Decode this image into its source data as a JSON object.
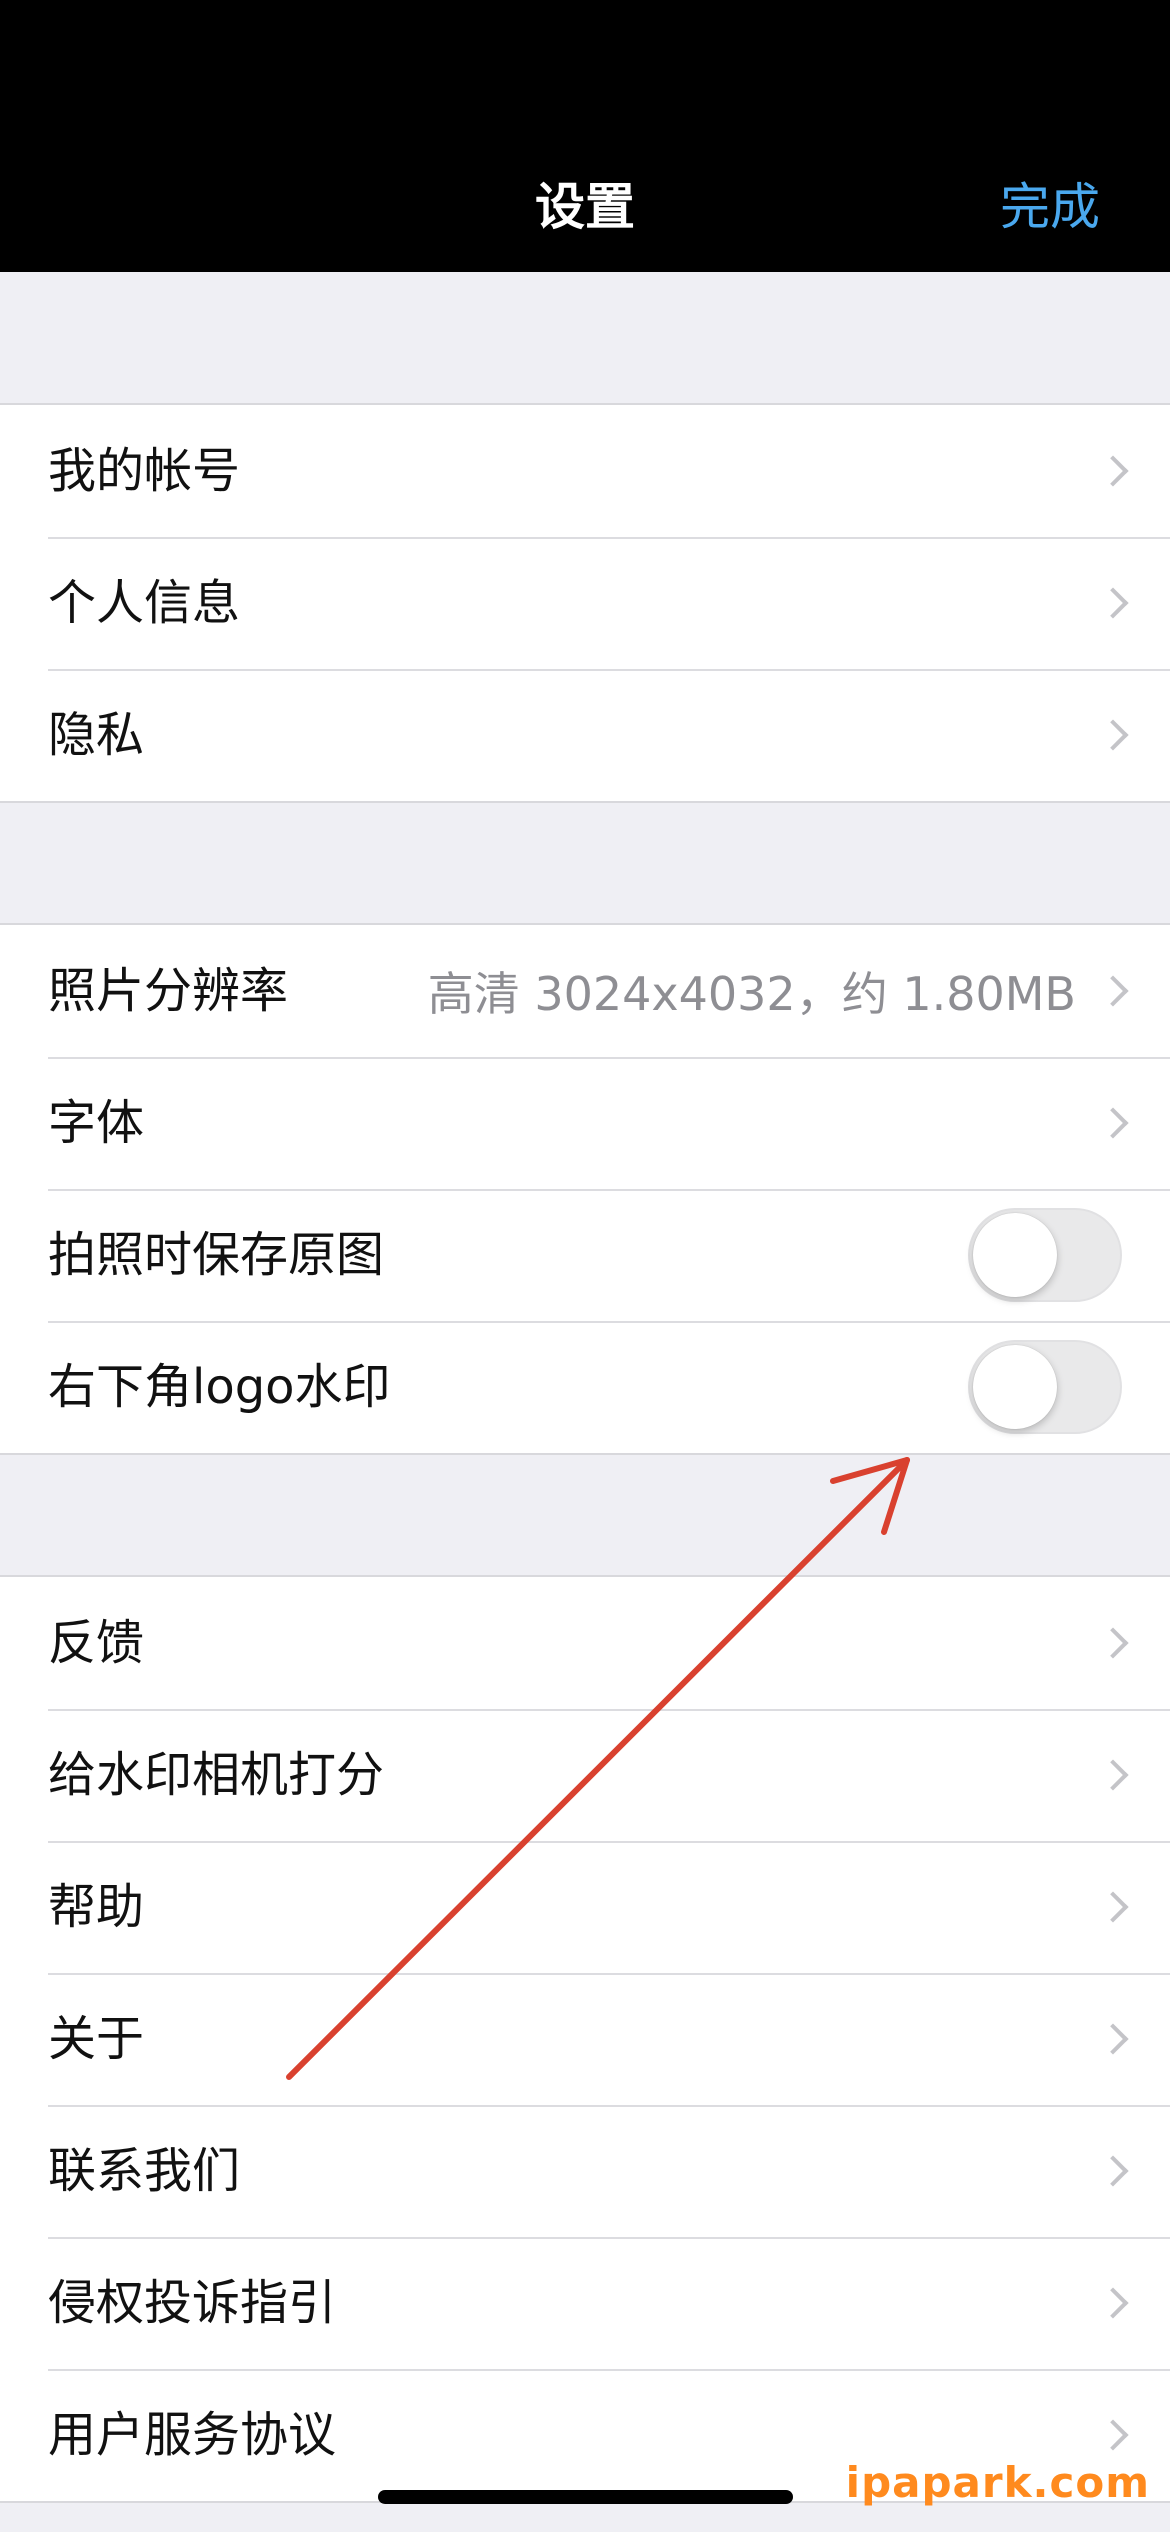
{
  "nav": {
    "title": "设置",
    "done": "完成"
  },
  "group1": [
    {
      "label": "我的帐号"
    },
    {
      "label": "个人信息"
    },
    {
      "label": "隐私"
    }
  ],
  "group2": [
    {
      "label": "照片分辨率",
      "detail": "高清 3024x4032，约 1.80MB"
    },
    {
      "label": "字体"
    },
    {
      "label": "拍照时保存原图",
      "toggle": false
    },
    {
      "label": "右下角logo水印",
      "toggle": false
    }
  ],
  "group3": [
    {
      "label": "反馈"
    },
    {
      "label": "给水印相机打分"
    },
    {
      "label": "帮助"
    },
    {
      "label": "关于"
    },
    {
      "label": "联系我们"
    },
    {
      "label": "侵权投诉指引"
    },
    {
      "label": "用户服务协议"
    }
  ],
  "watermark": "ipapark.com",
  "colors": {
    "accent": "#4aa8ee",
    "annotation": "#d9412f",
    "watermark": "#ff8a1e"
  },
  "icons": {
    "chevron": "chevron-right-icon",
    "arrow": "annotation-arrow"
  }
}
